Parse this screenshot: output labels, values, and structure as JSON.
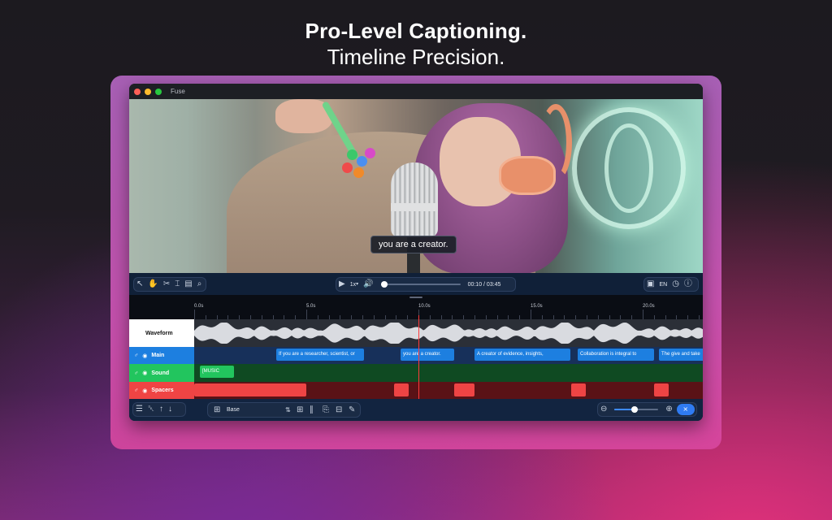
{
  "headline": {
    "line1": "Pro-Level Captioning.",
    "line2": "Timeline Precision."
  },
  "window": {
    "title": "Fuse"
  },
  "video": {
    "caption": "you are a creator."
  },
  "toolbar": {
    "tools": [
      "pointer-icon",
      "hand-icon",
      "scissors-icon",
      "text-cursor-icon",
      "clipboard-icon",
      "search-icon"
    ],
    "play_icon": "play-icon",
    "speed": "1x",
    "volume_icon": "speaker-icon",
    "progress": 0.05,
    "time": "00:10 / 03:45",
    "right_tools": [
      "image-icon",
      "language",
      "clock-icon",
      "help-icon"
    ],
    "language": "EN"
  },
  "timeline": {
    "ticks": [
      "0.0s",
      "5.0s",
      "10.0s",
      "15.0s",
      "20.0s"
    ],
    "tracks": {
      "waveform": {
        "label": "Waveform"
      },
      "main": {
        "label": "Main",
        "clips": [
          "If you are a researcher, scientist, or",
          "you are a creator.",
          "A creator of evidence, insights,",
          "Collaboration is integral to",
          "The give and take"
        ]
      },
      "sound": {
        "label": "Sound",
        "clips": [
          "[MUSIC"
        ]
      },
      "spacers": {
        "label": "Spacers"
      }
    }
  },
  "bottombar": {
    "left_icons": [
      "layers-icon",
      "trash-icon",
      "arrow-up-icon",
      "arrow-down-icon"
    ],
    "track_select": "Base",
    "edit_icons": [
      "add-caption-icon",
      "split-icon",
      "copy-icon",
      "merge-icon",
      "pencil-icon"
    ],
    "zoom": 0.45,
    "zoom_out_icon": "zoom-out-icon",
    "zoom_in_icon": "zoom-in-icon",
    "export_icon": "export-icon"
  },
  "colors": {
    "main_track": "#1d7fe0",
    "main_track_bg": "#17305a",
    "sound_track": "#22c55e",
    "sound_track_bg": "#0f4a22",
    "spacers_track": "#ef4444",
    "spacers_track_bg": "#5a1216",
    "playhead": "#ff3b3b"
  }
}
